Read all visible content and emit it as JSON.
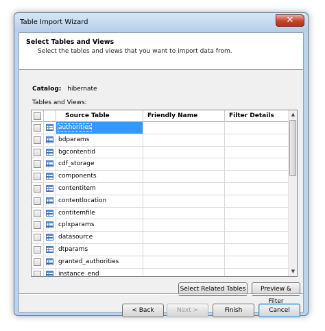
{
  "window": {
    "title": "Table Import Wizard",
    "close_glyph": "✕"
  },
  "header": {
    "title": "Select Tables and Views",
    "subtitle": "Select the tables and views that you want to import data from."
  },
  "catalog": {
    "label": "Catalog:",
    "value": "hibernate"
  },
  "tables_label": "Tables and Views:",
  "grid": {
    "columns": [
      "Source Table",
      "Friendly Name",
      "Filter Details"
    ],
    "rows": [
      {
        "source": "authorities",
        "friendly": "",
        "filter": "",
        "selected": true
      },
      {
        "source": "bdparams",
        "friendly": "",
        "filter": ""
      },
      {
        "source": "bgcontentid",
        "friendly": "",
        "filter": ""
      },
      {
        "source": "cdf_storage",
        "friendly": "",
        "filter": ""
      },
      {
        "source": "components",
        "friendly": "",
        "filter": ""
      },
      {
        "source": "contentitem",
        "friendly": "",
        "filter": ""
      },
      {
        "source": "contentlocation",
        "friendly": "",
        "filter": ""
      },
      {
        "source": "contitemfile",
        "friendly": "",
        "filter": ""
      },
      {
        "source": "cplxparams",
        "friendly": "",
        "filter": ""
      },
      {
        "source": "datasource",
        "friendly": "",
        "filter": ""
      },
      {
        "source": "dtparams",
        "friendly": "",
        "filter": ""
      },
      {
        "source": "granted_authorities",
        "friendly": "",
        "filter": ""
      },
      {
        "source": "instance_end",
        "friendly": "",
        "filter": ""
      }
    ]
  },
  "buttons": {
    "select_related": "Select Related Tables",
    "preview_filter": "Preview & Filter",
    "back": "< Back",
    "next": "Next >",
    "finish": "Finish",
    "cancel": "Cancel"
  },
  "icons": {
    "table": "table-icon",
    "close": "close-icon"
  },
  "colors": {
    "selection": "#3399ff",
    "title_bar": "#bcd3ec",
    "close": "#c7432a"
  }
}
